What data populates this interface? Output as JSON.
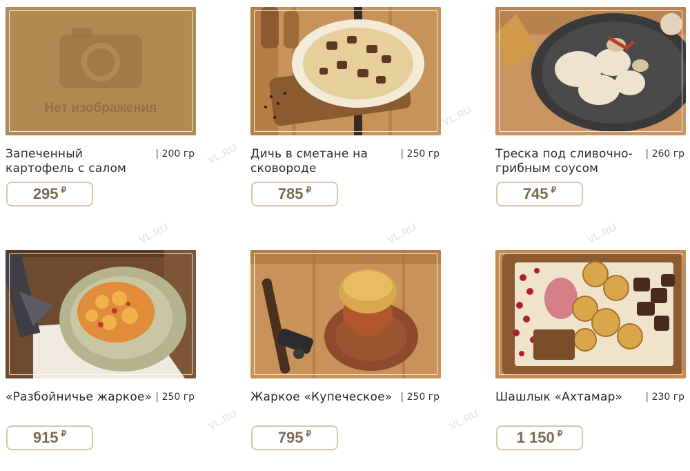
{
  "watermark": "VL.RU",
  "currency": "₽",
  "no_image_text": "Нет изображения",
  "colors": {
    "price_border": "#d7c8ac",
    "price_text": "#7b6a56",
    "placeholder_bg": "#b08a53"
  },
  "items": [
    {
      "name": "Запеченный картофель с салом",
      "weight": "200 гр",
      "price": "295"
    },
    {
      "name": "Дичь в сметане на сковороде",
      "weight": "250 гр",
      "price": "785"
    },
    {
      "name": "Треска под сливочно-грибным соусом",
      "weight": "260 гр",
      "price": "745"
    },
    {
      "name": "«Разбойничье жаркое»",
      "weight": "250 гр",
      "price": "915"
    },
    {
      "name": "Жаркое «Купеческое»",
      "weight": "250 гр",
      "price": "795"
    },
    {
      "name": "Шашлык «Ахтамар»",
      "weight": "230 гр",
      "price": "1 150"
    }
  ]
}
